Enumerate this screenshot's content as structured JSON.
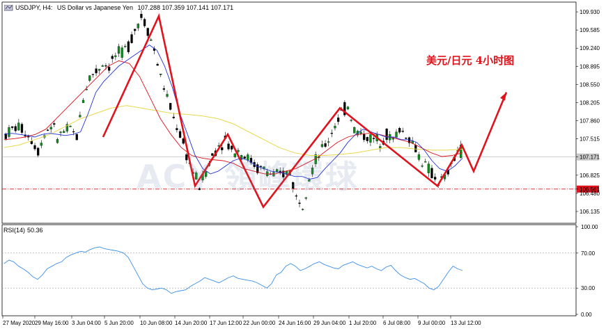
{
  "header": {
    "symbol": "USDJPY, H4:",
    "description": "US Dollar vs Japanese Yen",
    "ohlc": "107.288 107.359 107.141 107.171"
  },
  "annotation": "美元/日元 4小时图",
  "watermark": "ACY 領峰環球",
  "colors": {
    "bull": "#0a8f19",
    "bear": "#0a8f19",
    "ma_fast": "#2233dd",
    "ma_mid": "#e0121b",
    "ma_slow": "#e8d84a",
    "zigzag": "#e0121b",
    "support_line": "#e0121b",
    "rsi_line": "#3a8fe8"
  },
  "chart_data": [
    {
      "type": "candlestick",
      "symbol": "USDJPY",
      "timeframe": "H4",
      "ylim": [
        105.95,
        110.05
      ],
      "y_ticks": [
        "109.930",
        "109.585",
        "109.240",
        "108.895",
        "108.550",
        "108.205",
        "107.860",
        "107.515",
        "107.171",
        "106.825",
        "106.561",
        "106.480",
        "106.135"
      ],
      "current_price": "107.171",
      "support_level": "106.561",
      "x_ticks": [
        "27 May 2020",
        "29 May 16:00",
        "3 Jun 04:00",
        "5 Jun 20:00",
        "10 Jun 08:00",
        "14 Jun 20:00",
        "17 Jun 12:00",
        "22 Jun 00:00",
        "24 Jun 16:00",
        "29 Jun 04:00",
        "1 Jul 20:00",
        "6 Jul 08:00",
        "9 Jul 00:00",
        "13 Jul 12:00"
      ],
      "price_path": [
        107.6,
        107.7,
        107.75,
        107.65,
        107.5,
        107.3,
        107.6,
        107.8,
        107.55,
        107.65,
        107.7,
        107.55,
        108.3,
        108.7,
        108.8,
        108.95,
        108.9,
        109.1,
        109.15,
        109.3,
        109.6,
        109.85,
        109.6,
        109.2,
        108.7,
        108.3,
        107.9,
        107.6,
        107.2,
        106.9,
        106.62,
        106.9,
        107.2,
        107.4,
        107.5,
        107.3,
        107.3,
        107.2,
        107.1,
        106.95,
        106.95,
        106.85,
        106.8,
        106.85,
        106.9,
        106.4,
        106.3,
        106.8,
        107.1,
        107.3,
        107.5,
        107.8,
        108.0,
        108.15,
        107.7,
        107.6,
        107.55,
        107.5,
        107.5,
        107.6,
        107.5,
        107.7,
        107.6,
        107.45,
        107.2,
        107.0,
        106.85,
        106.7,
        106.75,
        107.0,
        107.3
      ],
      "ma_fast": [
        107.6,
        107.62,
        107.6,
        107.58,
        107.55,
        107.6,
        107.62,
        107.6,
        107.58,
        107.6,
        107.65,
        108.0,
        108.4,
        108.6,
        108.75,
        108.9,
        109.0,
        109.1,
        109.2,
        109.3,
        109.2,
        108.9,
        108.5,
        108.0,
        107.6,
        107.2,
        106.95,
        106.85,
        106.9,
        107.0,
        107.1,
        107.15,
        107.1,
        107.0,
        106.95,
        106.9,
        106.88,
        106.85,
        106.8,
        106.8,
        106.75,
        106.78,
        106.95,
        107.1,
        107.25,
        107.45,
        107.6,
        107.7,
        107.65,
        107.6,
        107.55,
        107.55,
        107.5,
        107.5,
        107.45,
        107.3,
        107.1,
        106.95,
        106.9,
        107.0,
        107.15
      ],
      "ma_mid": [
        107.5,
        107.52,
        107.55,
        107.6,
        107.7,
        107.9,
        108.1,
        108.3,
        108.5,
        108.7,
        108.9,
        109.0,
        108.95,
        108.7,
        108.3,
        107.9,
        107.6,
        107.35,
        107.2,
        107.15,
        107.12,
        107.1,
        107.05,
        106.95,
        106.9,
        106.85,
        106.85,
        106.9,
        106.95,
        107.05,
        107.15,
        107.3,
        107.45,
        107.55,
        107.6,
        107.62,
        107.6,
        107.55,
        107.5,
        107.45,
        107.35,
        107.25,
        107.18,
        107.2,
        107.25
      ],
      "ma_slow": [
        107.35,
        107.4,
        107.5,
        107.6,
        107.75,
        107.9,
        108.0,
        108.1,
        108.15,
        108.1,
        108.05,
        108.0,
        107.98,
        107.95,
        107.9,
        107.8,
        107.65,
        107.5,
        107.35,
        107.25,
        107.2,
        107.2,
        107.22,
        107.25,
        107.3,
        107.35,
        107.35,
        107.32,
        107.3,
        107.3,
        107.32
      ],
      "zigzag_points": [
        107.55,
        109.85,
        106.62,
        107.6,
        106.22,
        108.1,
        106.62,
        107.4,
        106.9,
        108.4
      ]
    },
    {
      "type": "line",
      "indicator": "RSI(14)",
      "value": "50.36",
      "ylim": [
        0,
        100
      ],
      "y_ticks": [
        "100.00",
        "70.00",
        "30.00",
        "0.00"
      ],
      "levels": [
        70,
        30
      ],
      "values": [
        58,
        62,
        60,
        55,
        52,
        48,
        43,
        40,
        45,
        52,
        55,
        58,
        60,
        65,
        68,
        70,
        72,
        71,
        74,
        76,
        77,
        75,
        74,
        73,
        72,
        70,
        65,
        55,
        45,
        35,
        30,
        28,
        29,
        30,
        28,
        24,
        26,
        27,
        28,
        32,
        35,
        38,
        42,
        40,
        38,
        36,
        39,
        42,
        44,
        41,
        40,
        39,
        38,
        36,
        33,
        30,
        35,
        45,
        48,
        55,
        58,
        55,
        50,
        52,
        55,
        58,
        60,
        57,
        55,
        53,
        52,
        56,
        58,
        60,
        57,
        55,
        53,
        55,
        52,
        50,
        54,
        56,
        50,
        45,
        42,
        40,
        41,
        38,
        35,
        30,
        28,
        32,
        40,
        48,
        55,
        52,
        50
      ]
    }
  ]
}
